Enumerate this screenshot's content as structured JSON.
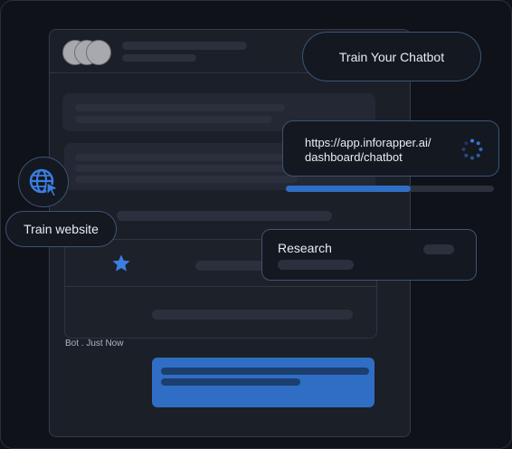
{
  "colors": {
    "accent": "#2f6ec4",
    "background": "#10131a",
    "window": "#1b1f28",
    "placeholder": "#2b303c",
    "pill_border": "#3c5476"
  },
  "chat_window": {
    "avatar_count": 3,
    "bot_message_meta": "Bot . Just Now"
  },
  "badges": {
    "train_chatbot": "Train Your Chatbot",
    "train_website": "Train website"
  },
  "url_card": {
    "url": "https://app.inforapper.ai/\ndashboard/chatbot",
    "status_icon": "loading-spinner-icon",
    "progress_fraction": 0.6
  },
  "research_card": {
    "label": "Research"
  },
  "icons": {
    "globe": "globe-cursor-icon",
    "star": "star-icon"
  }
}
